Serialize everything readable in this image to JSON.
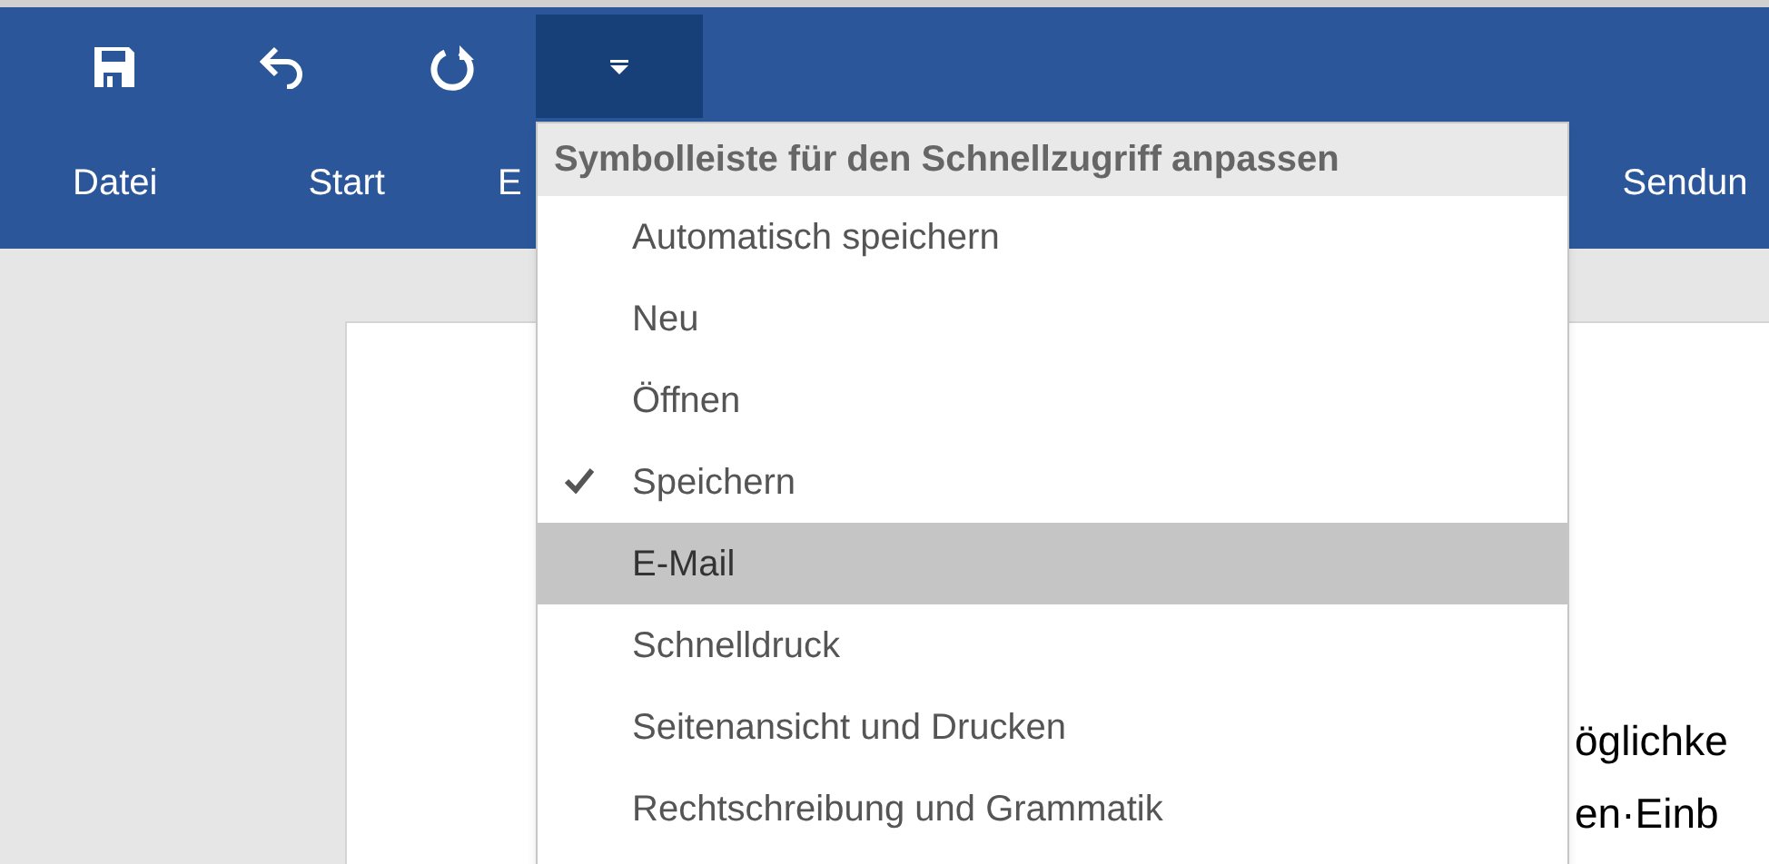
{
  "quick_access": {
    "dropdown_open": true
  },
  "tabs": [
    {
      "label": "Datei"
    },
    {
      "label": "Start"
    },
    {
      "label": "E"
    },
    {
      "label": "Sendun"
    }
  ],
  "document": {
    "lines": [
      "öglichke",
      "en·Einb"
    ]
  },
  "menu": {
    "title": "Symbolleiste für den Schnellzugriff anpassen",
    "items": [
      {
        "label": "Automatisch speichern",
        "checked": false,
        "selected": false
      },
      {
        "label": "Neu",
        "checked": false,
        "selected": false
      },
      {
        "label": "Öffnen",
        "checked": false,
        "selected": false
      },
      {
        "label": "Speichern",
        "checked": true,
        "selected": false
      },
      {
        "label": "E-Mail",
        "checked": false,
        "selected": true
      },
      {
        "label": "Schnelldruck",
        "checked": false,
        "selected": false
      },
      {
        "label": "Seitenansicht und Drucken",
        "checked": false,
        "selected": false
      },
      {
        "label": "Rechtschreibung und Grammatik",
        "checked": false,
        "selected": false
      }
    ]
  }
}
